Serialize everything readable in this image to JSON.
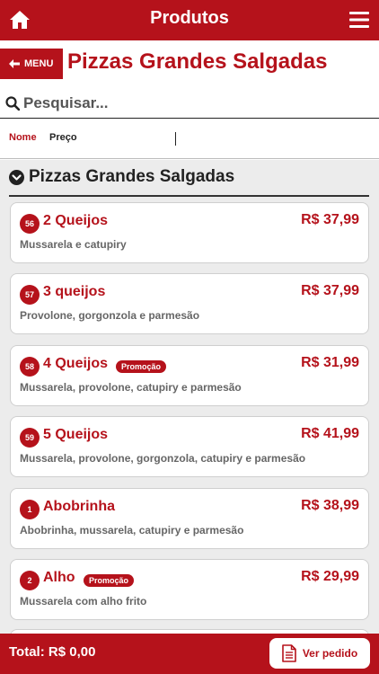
{
  "header": {
    "title": "Produtos",
    "home_icon": "home-icon",
    "menu_icon": "hamburger-menu-icon"
  },
  "nav": {
    "back_label": "MENU",
    "page_title": "Pizzas Grandes Salgadas"
  },
  "search": {
    "placeholder": "Pesquisar...",
    "value": ""
  },
  "sort": {
    "nome_label": "Nome",
    "preco_label": "Preço"
  },
  "section": {
    "title": "Pizzas Grandes Salgadas"
  },
  "products": [
    {
      "number": "56",
      "name": "2 Queijos",
      "promo": "",
      "price": "R$ 37,99",
      "description": "Mussarela e catupiry"
    },
    {
      "number": "57",
      "name": "3 queijos",
      "promo": "",
      "price": "R$ 37,99",
      "description": "Provolone, gorgonzola e parmesão"
    },
    {
      "number": "58",
      "name": "4 Queijos",
      "promo": "Promoção",
      "price": "R$ 31,99",
      "description": "Mussarela, provolone, catupiry e parmesão"
    },
    {
      "number": "59",
      "name": "5 Queijos",
      "promo": "",
      "price": "R$ 41,99",
      "description": "Mussarela, provolone, gorgonzola, catupiry e parmesão"
    },
    {
      "number": "1",
      "name": "Abobrinha",
      "promo": "",
      "price": "R$ 38,99",
      "description": "Abobrinha, mussarela, catupiry e parmesão"
    },
    {
      "number": "2",
      "name": "Alho",
      "promo": "Promoção",
      "price": "R$ 29,99",
      "description": "Mussarela com alho frito"
    }
  ],
  "footer": {
    "total_label": "Total: R$ 0,00",
    "order_button": "Ver pedido"
  },
  "colors": {
    "brand_red": "#b5121b",
    "list_background": "#ececec"
  }
}
